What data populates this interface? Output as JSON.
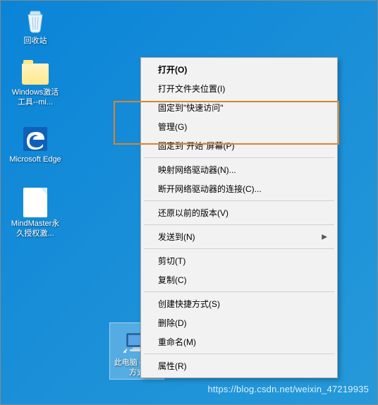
{
  "icons": {
    "recycle_bin": "回收站",
    "windows_activate": "Windows激活工具--mi...",
    "edge": "Microsoft Edge",
    "mindmaster": "MindMaster永久授权激...",
    "this_pc": "此电脑 - 快捷方式"
  },
  "context_menu": {
    "open": "打开(O)",
    "open_folder_location": "打开文件夹位置(I)",
    "pin_quick_access": "固定到\"快速访问\"",
    "manage": "管理(G)",
    "pin_start": "固定到\"开始\"屏幕(P)",
    "map_drive": "映射网络驱动器(N)...",
    "disconnect_drive": "断开网络驱动器的连接(C)...",
    "restore_previous": "还原以前的版本(V)",
    "send_to": "发送到(N)",
    "cut": "剪切(T)",
    "copy": "复制(C)",
    "create_shortcut": "创建快捷方式(S)",
    "delete": "删除(D)",
    "rename": "重命名(M)",
    "properties": "属性(R)"
  },
  "watermark": "https://blog.csdn.net/weixin_47219935"
}
